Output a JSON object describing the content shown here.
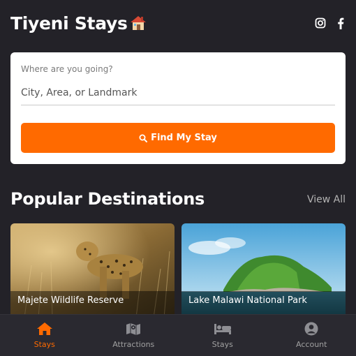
{
  "header": {
    "brand": "Tiyeni Stays",
    "brand_icon": "house-emoji",
    "social_icons": [
      "instagram-icon",
      "facebook-icon"
    ]
  },
  "search": {
    "label": "Where are you going?",
    "placeholder": "City, Area, or Landmark",
    "value": "",
    "button_label": "Find My Stay",
    "button_icon": "search-icon"
  },
  "destinations": {
    "title": "Popular Destinations",
    "view_all": "View All",
    "items": [
      {
        "name": "Majete Wildlife Reserve",
        "image": "leopard-photo"
      },
      {
        "name": "Lake Malawi National Park",
        "image": "island-lake-photo"
      }
    ]
  },
  "nav": {
    "items": [
      {
        "label": "Stays",
        "icon": "home-icon",
        "active": true
      },
      {
        "label": "Attractions",
        "icon": "map-icon",
        "active": false
      },
      {
        "label": "Stays",
        "icon": "bed-icon",
        "active": false
      },
      {
        "label": "Account",
        "icon": "account-icon",
        "active": false
      }
    ]
  },
  "colors": {
    "accent": "#ff6a00",
    "background": "#232228",
    "card": "#ffffff",
    "nav_background": "#2a2930"
  }
}
